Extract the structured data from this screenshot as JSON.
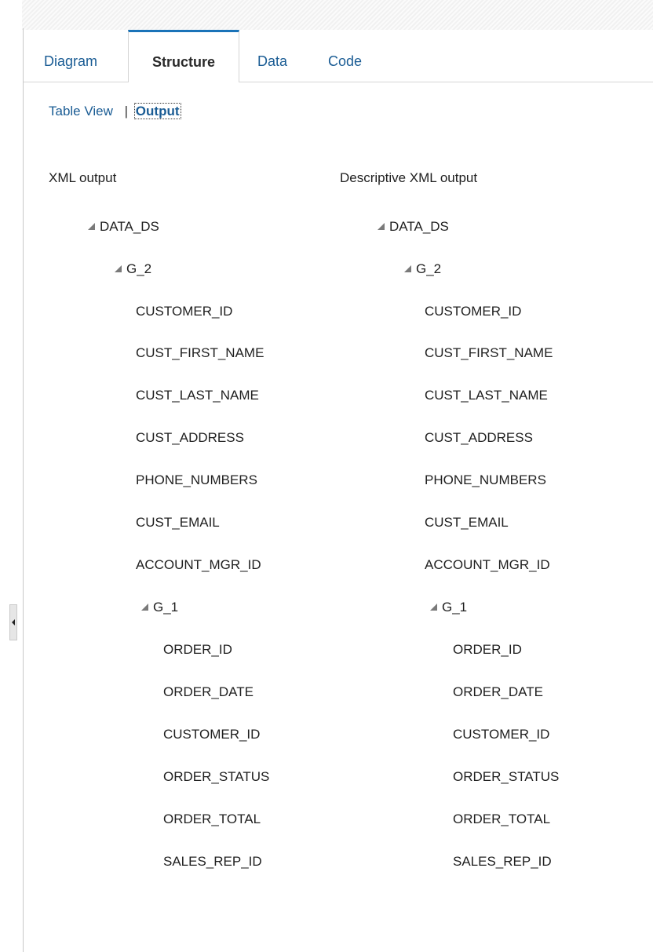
{
  "tabs": [
    {
      "label": "Diagram",
      "active": false
    },
    {
      "label": "Structure",
      "active": true
    },
    {
      "label": "Data",
      "active": false
    },
    {
      "label": "Code",
      "active": false
    }
  ],
  "subnav": {
    "table_view": "Table View",
    "separator": "|",
    "output": "Output"
  },
  "xml_output": {
    "header": "XML output",
    "root": "DATA_DS",
    "group_outer": "G_2",
    "outer_fields": [
      "CUSTOMER_ID",
      "CUST_FIRST_NAME",
      "CUST_LAST_NAME",
      "CUST_ADDRESS",
      "PHONE_NUMBERS",
      "CUST_EMAIL",
      "ACCOUNT_MGR_ID"
    ],
    "group_inner": "G_1",
    "inner_fields": [
      "ORDER_ID",
      "ORDER_DATE",
      "CUSTOMER_ID",
      "ORDER_STATUS",
      "ORDER_TOTAL",
      "SALES_REP_ID"
    ]
  },
  "descriptive_xml_output": {
    "header": "Descriptive XML output",
    "root": "DATA_DS",
    "group_outer": "G_2",
    "outer_fields": [
      "CUSTOMER_ID",
      "CUST_FIRST_NAME",
      "CUST_LAST_NAME",
      "CUST_ADDRESS",
      "PHONE_NUMBERS",
      "CUST_EMAIL",
      "ACCOUNT_MGR_ID"
    ],
    "group_inner": "G_1",
    "inner_fields": [
      "ORDER_ID",
      "ORDER_DATE",
      "CUSTOMER_ID",
      "ORDER_STATUS",
      "ORDER_TOTAL",
      "SALES_REP_ID"
    ]
  },
  "icons": {
    "expanded_node": "triangle-expanded-icon",
    "collapse_panel": "chevron-left-icon"
  },
  "colors": {
    "link": "#1a5c94",
    "active_tab_border": "#1a73b8",
    "text": "#1f1f1f",
    "node_arrow": "#7a7a7a"
  }
}
